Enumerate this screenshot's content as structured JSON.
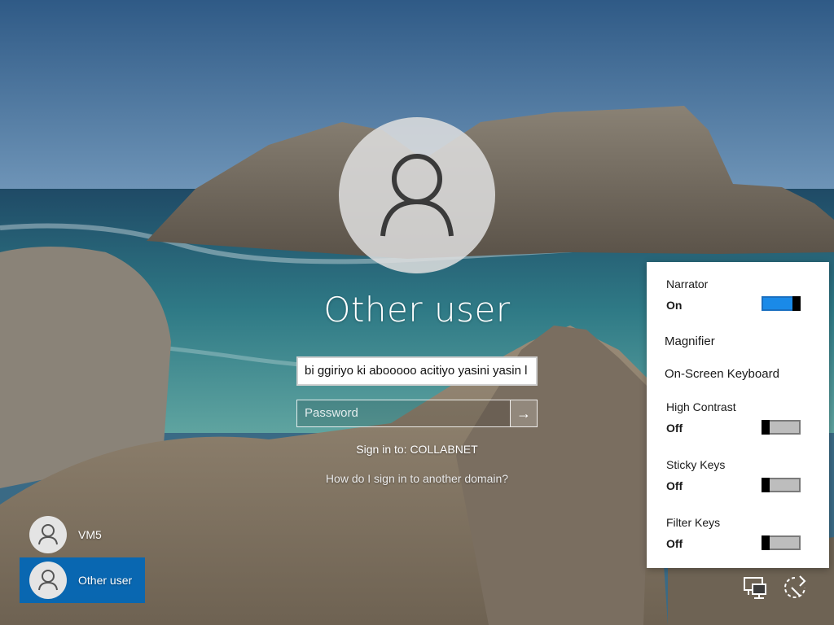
{
  "login": {
    "display_name": "Other user",
    "username_value": "bi ggiriyo ki abooooo acitiyo yasini yasin l",
    "password_placeholder": "Password",
    "sign_in_to": "Sign in to: COLLABNET",
    "domain_link": "How do I sign in to another domain?"
  },
  "user_list": [
    {
      "name": "VM5",
      "selected": false
    },
    {
      "name": "Other user",
      "selected": true
    }
  ],
  "ease_of_access": {
    "narrator": {
      "label": "Narrator",
      "state": "On"
    },
    "magnifier": {
      "label": "Magnifier"
    },
    "onscreen_keyboard": {
      "label": "On-Screen Keyboard"
    },
    "high_contrast": {
      "label": "High Contrast",
      "state": "Off"
    },
    "sticky_keys": {
      "label": "Sticky Keys",
      "state": "Off"
    },
    "filter_keys": {
      "label": "Filter Keys",
      "state": "Off"
    }
  },
  "icons": {
    "submit": "arrow-right-icon",
    "network": "network-icon",
    "power": "power-icon"
  },
  "colors": {
    "selected_tile": "#0067b8",
    "toggle_on": "#1a8ae8"
  }
}
